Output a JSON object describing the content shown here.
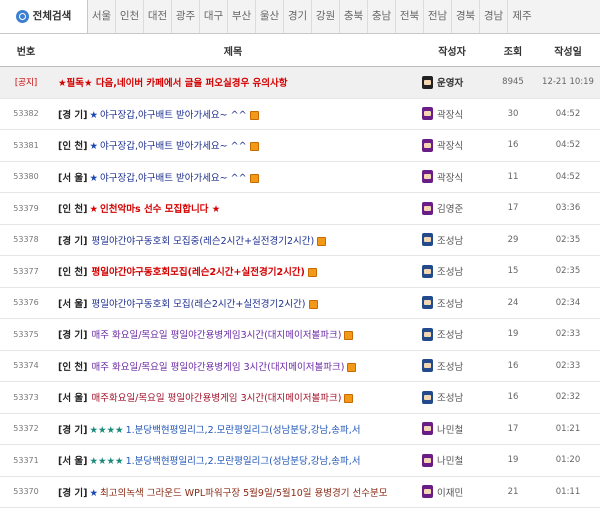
{
  "tabs": {
    "all_label": "전체검색",
    "regions": [
      "서울",
      "인천",
      "대전",
      "광주",
      "대구",
      "부산",
      "울산",
      "경기",
      "강원",
      "충북",
      "충남",
      "전북",
      "전남",
      "경북",
      "경남",
      "제주"
    ]
  },
  "columns": {
    "no": "번호",
    "title": "제목",
    "author": "작성자",
    "views": "조회",
    "date": "작성일"
  },
  "rows": [
    {
      "no": "[공지]",
      "tag": "",
      "subject": "★필독★ 다음,네이버 카페에서 글을 퍼오실경우 유의사항",
      "author": "운영자",
      "views": "8945",
      "date": "12-21 10:19"
    },
    {
      "no": "53382",
      "tag": "[경 기]",
      "star": "★",
      "subject": "야구장갑,야구배트 받아가세요~ ^^",
      "author": "곽장식",
      "views": "30",
      "date": "04:52"
    },
    {
      "no": "53381",
      "tag": "[인 천]",
      "star": "★",
      "subject": "야구장갑,야구배트 받아가세요~ ^^",
      "author": "곽장식",
      "views": "16",
      "date": "04:52"
    },
    {
      "no": "53380",
      "tag": "[서 울]",
      "star": "★",
      "subject": "야구장갑,야구배트 받아가세요~ ^^",
      "author": "곽장식",
      "views": "11",
      "date": "04:52"
    },
    {
      "no": "53379",
      "tag": "[인 천]",
      "star": "★",
      "subject": "인천악마s 선수 모집합니다 ★",
      "author": "김영준",
      "views": "17",
      "date": "03:36"
    },
    {
      "no": "53378",
      "tag": "[경 기]",
      "star": "",
      "subject": "평일야간야구동호회 모집중(레슨2시간+실전경기2시간)",
      "author": "조성남",
      "views": "29",
      "date": "02:35"
    },
    {
      "no": "53377",
      "tag": "[인 천]",
      "star": "",
      "subject": "평일야간야구동호회모집(레슨2시간+실전경기2시간)",
      "author": "조성남",
      "views": "15",
      "date": "02:35"
    },
    {
      "no": "53376",
      "tag": "[서 울]",
      "star": "",
      "subject": "평일야간야구동호회 모집(레슨2시간+실전경기2시간)",
      "author": "조성남",
      "views": "24",
      "date": "02:34"
    },
    {
      "no": "53375",
      "tag": "[경 기]",
      "star": "",
      "subject": "매주 화요일/목요일 평일야간용병게임3시간(대지메이저볼파크)",
      "author": "조성남",
      "views": "19",
      "date": "02:33"
    },
    {
      "no": "53374",
      "tag": "[인 천]",
      "star": "",
      "subject": "매주 화요일/목요일 평일야간용병게임 3시간(대지메이저볼파크)",
      "author": "조성남",
      "views": "16",
      "date": "02:33"
    },
    {
      "no": "53373",
      "tag": "[서 울]",
      "star": "",
      "subject": "매주화요일/목요일 평일야간용병게임 3시간(대지메이저볼파크)",
      "author": "조성남",
      "views": "16",
      "date": "02:32"
    },
    {
      "no": "53372",
      "tag": "[경 기]",
      "star": "★★★★",
      "subject": "1.분당백현평일리그,2.모란평일리그(성남분당,강남,송파,서",
      "author": "나민철",
      "views": "17",
      "date": "01:21"
    },
    {
      "no": "53371",
      "tag": "[서 울]",
      "star": "★★★★",
      "subject": "1.분당백현평일리그,2.모란평일리그(성남분당,강남,송파,서",
      "author": "나민철",
      "views": "19",
      "date": "01:20"
    },
    {
      "no": "53370",
      "tag": "[경 기]",
      "star": "★",
      "subject": "최고의녹색 그라운드 WPL파워구장 5월9일/5월10일 용병경기 선수분모",
      "author": "이재민",
      "views": "21",
      "date": "01:11"
    }
  ],
  "colors": {
    "notice_bg": "#f0f0f0",
    "notice_red": "#d40000",
    "star_blue": "#1b45b5",
    "new_icon": "#f29a17"
  }
}
